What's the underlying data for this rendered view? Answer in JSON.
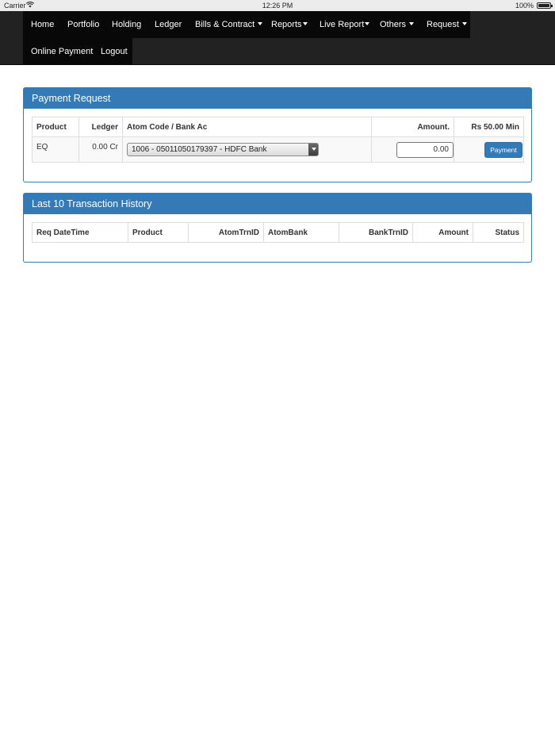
{
  "status_bar": {
    "carrier": "Carrier",
    "time": "12:26 PM",
    "battery": "100%"
  },
  "nav": {
    "items": [
      {
        "label": "Home"
      },
      {
        "label": "Portfolio"
      },
      {
        "label": "Holding"
      },
      {
        "label": "Ledger"
      },
      {
        "label": "Bills & Contract"
      },
      {
        "label": "Reports"
      },
      {
        "label": "Live Report"
      },
      {
        "label": "Others"
      },
      {
        "label": "Request"
      },
      {
        "label": "Online Payment"
      },
      {
        "label": "Logout"
      }
    ]
  },
  "payment_request": {
    "title": "Payment Request",
    "headers": [
      "Product",
      "Ledger",
      "Atom Code / Bank Ac",
      "Amount.",
      "Rs 50.00 Min"
    ],
    "row": {
      "product": "EQ",
      "ledger": "0.00 Cr",
      "bank_selected": "1006 - 05011050179397 - HDFC Bank",
      "amount": "0.00",
      "button_label": "Payment"
    }
  },
  "history": {
    "title": "Last 10 Transaction History",
    "headers": [
      "Req DateTime",
      "Product",
      "AtomTrnID",
      "AtomBank",
      "BankTrnID",
      "Amount",
      "Status"
    ]
  },
  "colors": {
    "panel_primary": "#337ab7",
    "nav_bg": "#222222",
    "nav_active": "#080808"
  }
}
